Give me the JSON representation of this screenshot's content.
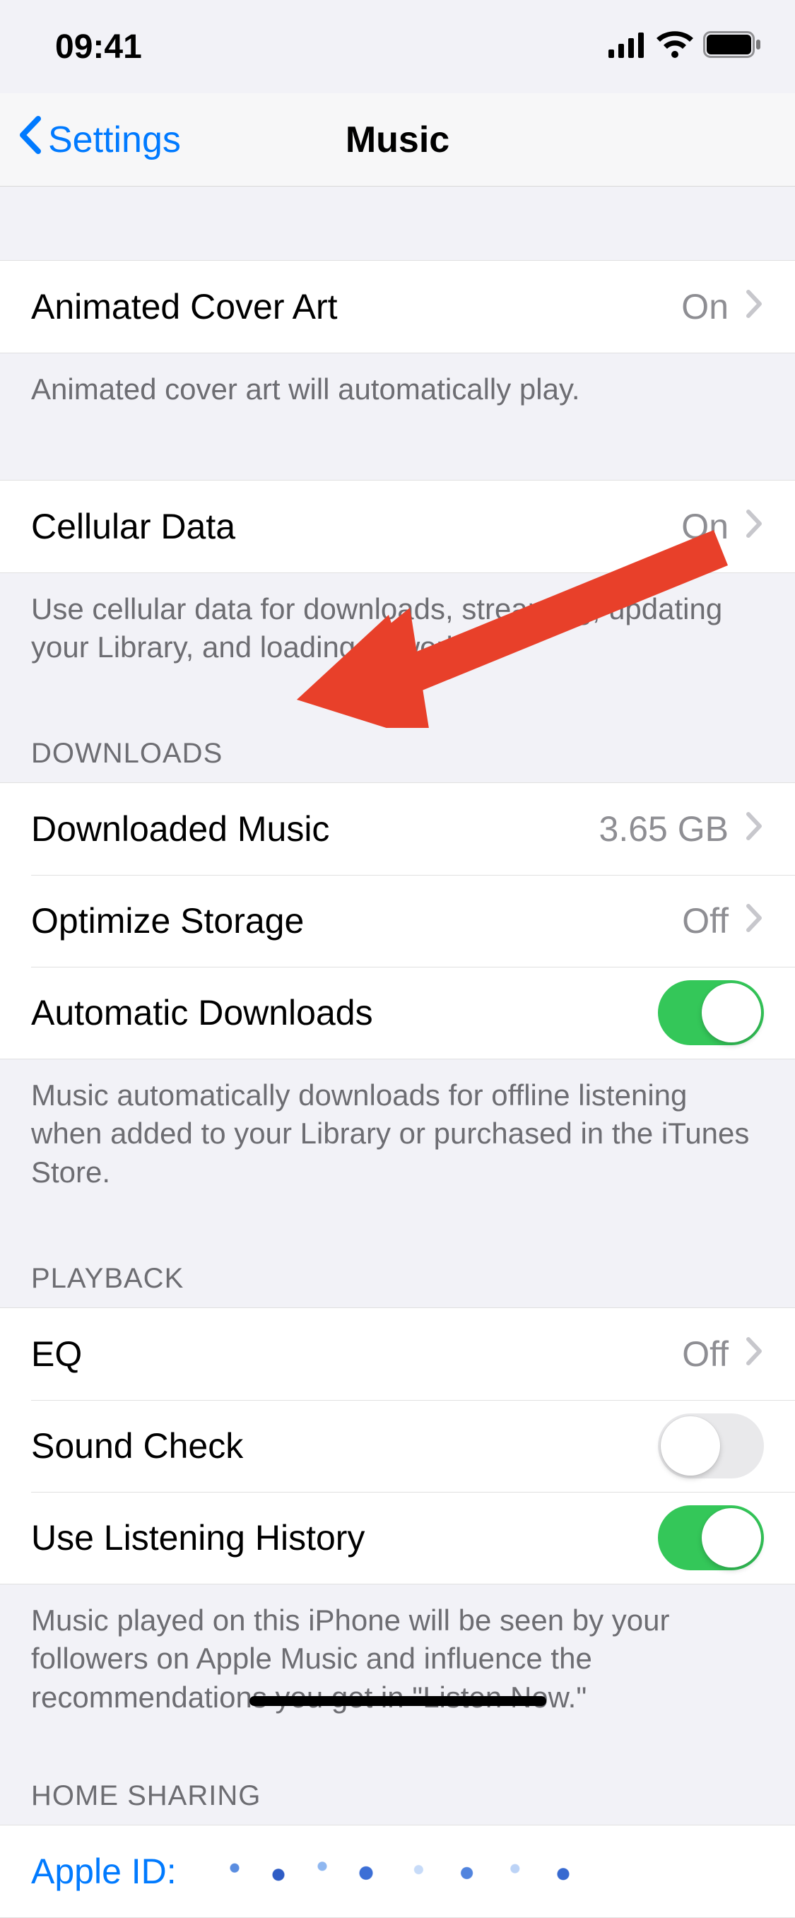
{
  "status": {
    "time": "09:41"
  },
  "nav": {
    "back": "Settings",
    "title": "Music"
  },
  "rows": {
    "animatedCoverArt": {
      "label": "Animated Cover Art",
      "value": "On"
    },
    "animatedCoverArt_footer": "Animated cover art will automatically play.",
    "cellularData": {
      "label": "Cellular Data",
      "value": "On"
    },
    "cellularData_footer": "Use cellular data for downloads, streaming, updating your Library, and loading artwork.",
    "downloads_header": "DOWNLOADS",
    "downloadedMusic": {
      "label": "Downloaded Music",
      "value": "3.65 GB"
    },
    "optimizeStorage": {
      "label": "Optimize Storage",
      "value": "Off"
    },
    "automaticDownloads": {
      "label": "Automatic Downloads",
      "on": true
    },
    "automaticDownloads_footer": "Music automatically downloads for offline listening when added to your Library or purchased in the iTunes Store.",
    "playback_header": "PLAYBACK",
    "eq": {
      "label": "EQ",
      "value": "Off"
    },
    "soundCheck": {
      "label": "Sound Check",
      "on": false
    },
    "useListeningHistory": {
      "label": "Use Listening History",
      "on": true
    },
    "listeningHistory_footer": "Music played on this iPhone will be seen by your followers on Apple Music and influence the recommendations you get in \"Listen Now.\"",
    "homeSharing_header": "HOME SHARING",
    "appleIdLabel": "Apple ID:"
  }
}
